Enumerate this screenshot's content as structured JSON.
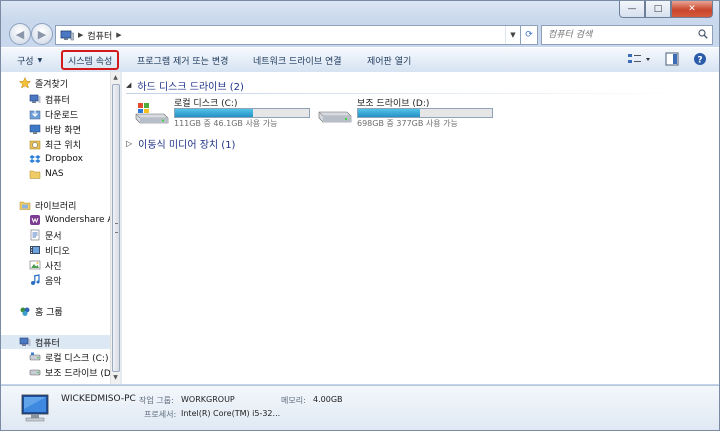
{
  "window": {
    "caption": {
      "minimize": "—",
      "maximize": "□",
      "close": "✕"
    }
  },
  "address": {
    "crumb": "컴퓨터",
    "search_placeholder": "컴퓨터 검색"
  },
  "toolbar": {
    "organize": "구성",
    "system_properties": "시스템 속성",
    "uninstall": "프로그램 제거 또는 변경",
    "map_drive": "네트워크 드라이브 연결",
    "control_panel": "제어판 열기"
  },
  "nav": {
    "favorites": "즐겨찾기",
    "favorites_items": [
      "컴퓨터",
      "다운로드",
      "바탕 화면",
      "최근 위치",
      "Dropbox",
      "NAS"
    ],
    "libraries": "라이브러리",
    "library_items": [
      "Wondershare All",
      "문서",
      "비디오",
      "사진",
      "음악"
    ],
    "homegroup": "홈 그룹",
    "computer": "컴퓨터",
    "computer_items": [
      "로컬 디스크 (C:)",
      "보조 드라이브 (D"
    ]
  },
  "content": {
    "hdd_group": "하드 디스크 드라이브 (2)",
    "removable_group": "이동식 미디어 장치 (1)",
    "drives": [
      {
        "name": "로컬 디스크 (C:)",
        "size": "111GB 중 46.1GB 사용 가능",
        "used_fraction": 0.58
      },
      {
        "name": "보조 드라이브 (D:)",
        "size": "698GB 중 377GB 사용 가능",
        "used_fraction": 0.46
      }
    ]
  },
  "details": {
    "pc_name": "WICKEDMISO-PC",
    "workgroup_label": "작업 그룹:",
    "workgroup_value": "WORKGROUP",
    "memory_label": "메모리:",
    "memory_value": "4.00GB",
    "processor_label": "프로세서:",
    "processor_value": "Intel(R) Core(TM) i5-32..."
  }
}
